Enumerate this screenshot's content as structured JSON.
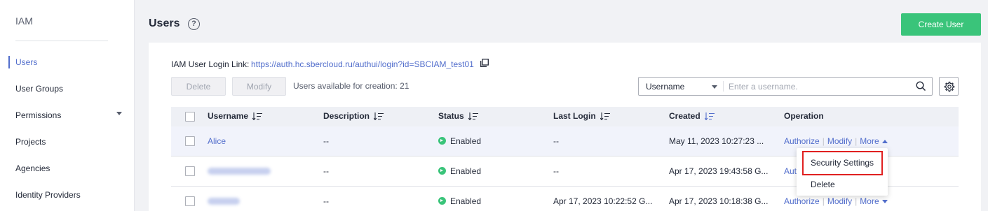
{
  "sidebar": {
    "brand": "IAM",
    "items": [
      {
        "label": "Users",
        "active": true
      },
      {
        "label": "User Groups"
      },
      {
        "label": "Permissions"
      },
      {
        "label": "Projects"
      },
      {
        "label": "Agencies"
      },
      {
        "label": "Identity Providers"
      }
    ]
  },
  "header": {
    "title": "Users",
    "help_icon": "?",
    "create_label": "Create User"
  },
  "toolbar": {
    "login_label": "IAM User Login Link:",
    "login_url": "https://auth.hc.sbercloud.ru/authui/login?id=SBCIAM_test01",
    "delete_label": "Delete",
    "modify_label": "Modify",
    "quota_text": "Users available for creation: 21"
  },
  "search": {
    "field": "Username",
    "placeholder": "Enter a username."
  },
  "table": {
    "columns": [
      "Username",
      "Description",
      "Status",
      "Last Login",
      "Created",
      "Operation"
    ],
    "rows": [
      {
        "username": "Alice",
        "description": "--",
        "status": "Enabled",
        "last_login": "--",
        "created": "May 11, 2023 10:27:23 ..."
      },
      {
        "username": "",
        "description": "--",
        "status": "Enabled",
        "last_login": "--",
        "created": "Apr 17, 2023 19:43:58 G..."
      },
      {
        "username": "",
        "description": "--",
        "status": "Enabled",
        "last_login": "Apr 17, 2023 10:22:52 G...",
        "created": "Apr 17, 2023 10:18:38 G..."
      }
    ],
    "op_authorize": "Authorize",
    "op_authorize_short": "Aut",
    "op_modify": "Modify",
    "op_more": "More",
    "op_sep": "|"
  },
  "more_menu": {
    "items": [
      "Security Settings",
      "Delete"
    ]
  },
  "colors": {
    "accent": "#526ecc",
    "create_button": "#3ac47a",
    "status_enabled": "#3ac47a",
    "highlight_box": "#e02020"
  }
}
